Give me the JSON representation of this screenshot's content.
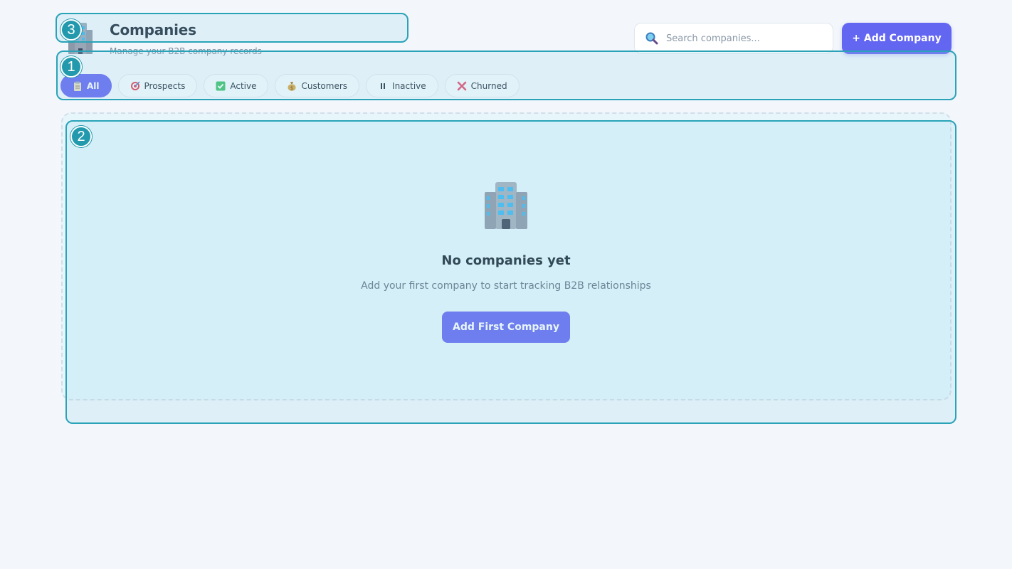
{
  "header": {
    "title": "Companies",
    "subtitle": "Manage your B2B company records",
    "logo_icon": "office-building-icon"
  },
  "search": {
    "placeholder": "Search companies...",
    "value": "",
    "icon": "magnifying-glass-icon"
  },
  "toolbar": {
    "add_label": "+ Add Company"
  },
  "filters": [
    {
      "label": "All",
      "icon": "clipboard-icon",
      "active": true
    },
    {
      "label": "Prospects",
      "icon": "target-icon",
      "active": false
    },
    {
      "label": "Active",
      "icon": "check-box-icon",
      "active": false
    },
    {
      "label": "Customers",
      "icon": "money-bag-icon",
      "active": false
    },
    {
      "label": "Inactive",
      "icon": "pause-icon",
      "active": false
    },
    {
      "label": "Churned",
      "icon": "cross-mark-icon",
      "active": false
    }
  ],
  "empty_state": {
    "icon": "office-building-icon",
    "title": "No companies yet",
    "subtitle": "Add your first company to start tracking B2B relationships",
    "button_label": "Add First Company"
  },
  "annotations": [
    {
      "badge": "1"
    },
    {
      "badge": "2"
    },
    {
      "badge": "3"
    }
  ],
  "colors": {
    "accent": "#6366f1",
    "background": "#f3f7fb",
    "annotation": "#2aa3b8",
    "title_text": "#1b2838",
    "muted_text": "#7a8ca0"
  }
}
